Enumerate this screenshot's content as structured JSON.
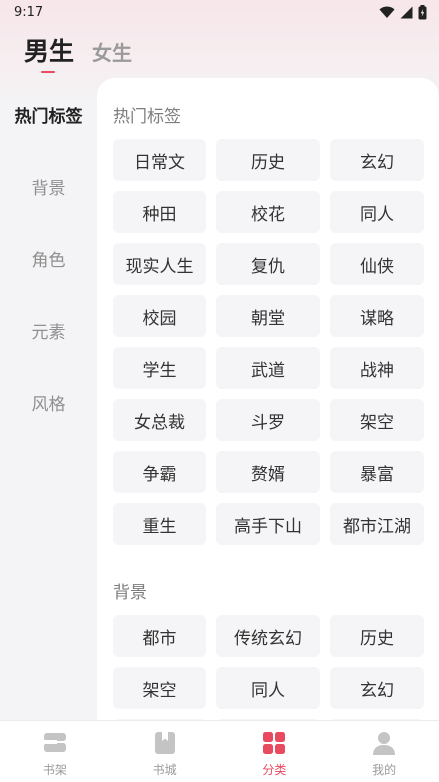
{
  "status": {
    "time": "9:17"
  },
  "gender_tabs": [
    {
      "label": "男生",
      "active": true
    },
    {
      "label": "女生",
      "active": false
    }
  ],
  "sidebar": {
    "items": [
      {
        "label": "热门标签",
        "active": true
      },
      {
        "label": "背景",
        "active": false
      },
      {
        "label": "角色",
        "active": false
      },
      {
        "label": "元素",
        "active": false
      },
      {
        "label": "风格",
        "active": false
      }
    ]
  },
  "sections": [
    {
      "title": "热门标签",
      "tags": [
        "日常文",
        "历史",
        "玄幻",
        "种田",
        "校花",
        "同人",
        "现实人生",
        "复仇",
        "仙侠",
        "校园",
        "朝堂",
        "谋略",
        "学生",
        "武道",
        "战神",
        "女总裁",
        "斗罗",
        "架空",
        "争霸",
        "赘婿",
        "暴富",
        "重生",
        "高手下山",
        "都市江湖"
      ]
    },
    {
      "title": "背景",
      "tags": [
        "都市",
        "传统玄幻",
        "历史",
        "架空",
        "同人",
        "玄幻",
        "",
        "",
        ""
      ]
    }
  ],
  "bottom_nav": [
    {
      "label": "书架",
      "icon": "bookshelf-icon",
      "active": false
    },
    {
      "label": "书城",
      "icon": "bookstore-icon",
      "active": false
    },
    {
      "label": "分类",
      "icon": "category-icon",
      "active": true
    },
    {
      "label": "我的",
      "icon": "profile-icon",
      "active": false
    }
  ],
  "colors": {
    "accent": "#e84a5f",
    "inactive_icon": "#c4c4c4"
  }
}
